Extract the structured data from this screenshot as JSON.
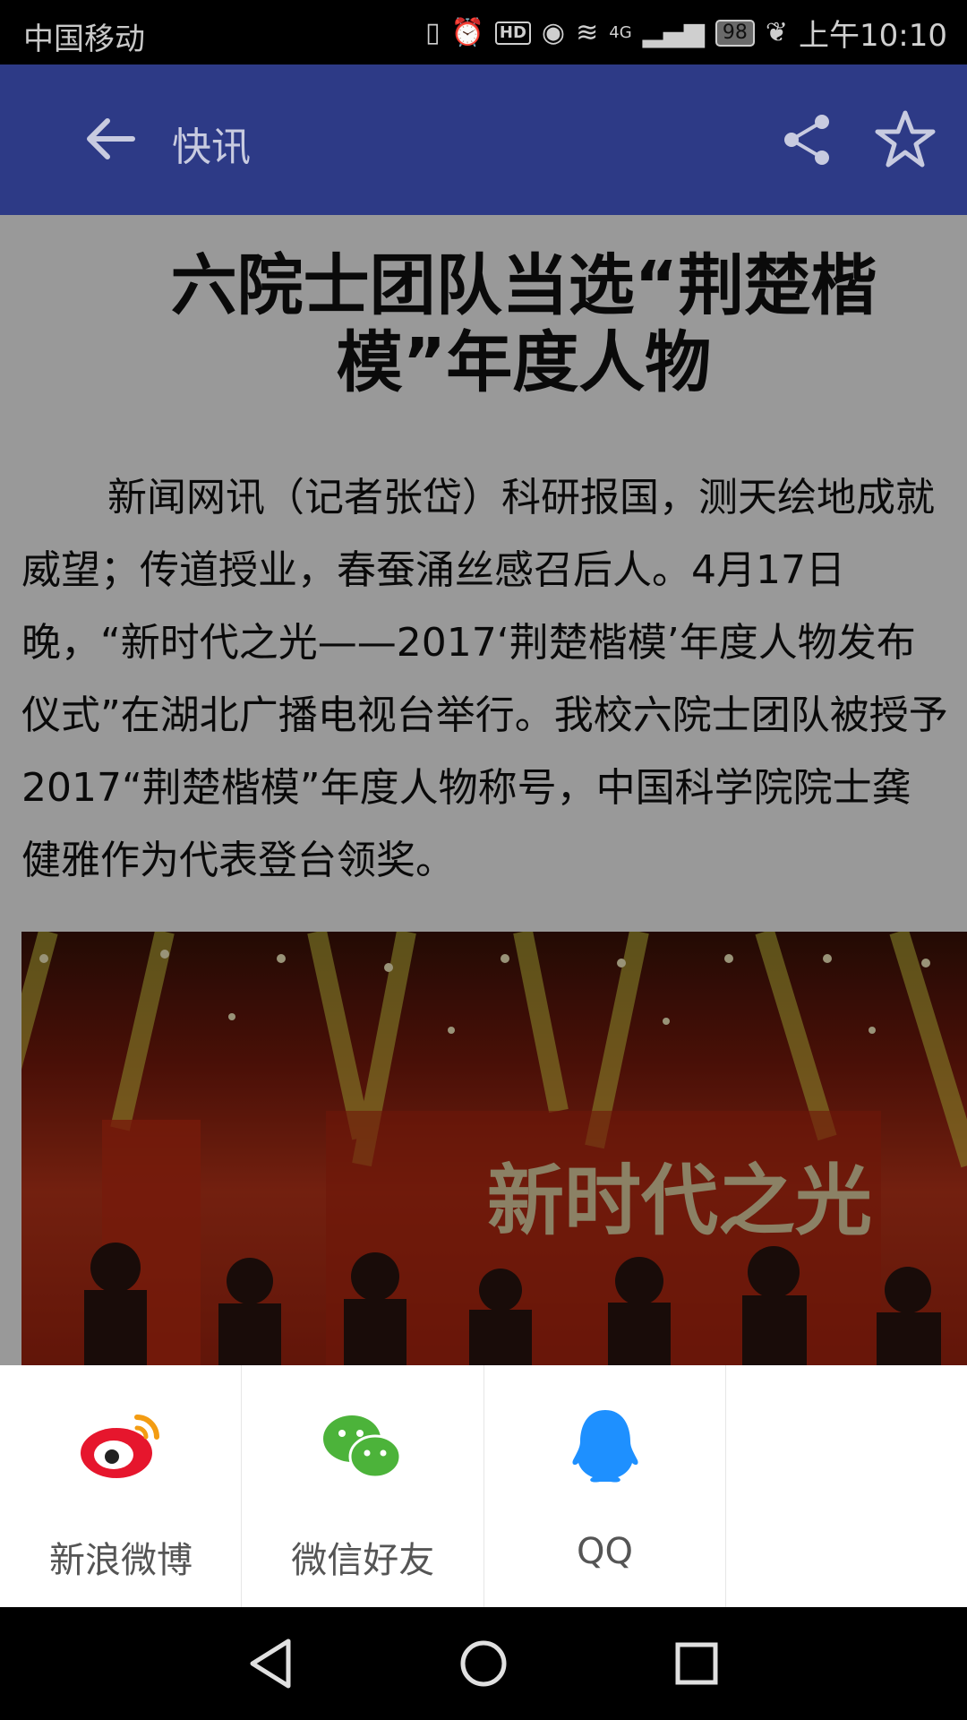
{
  "status_bar": {
    "carrier": "中国移动",
    "network": "4G",
    "hd": "HD",
    "battery": "98",
    "time": "上午10:10"
  },
  "app_bar": {
    "title": "快讯"
  },
  "article": {
    "headline": "六院士团队当选“荆楚楷模”年度人物",
    "body": "新闻网讯（记者张岱）科研报国，测天绘地成就威望；传道授业，春蚕涌丝感召后人。4月17日晚，“新时代之光——2017‘荆楚楷模’年度人物发布仪式”在湖北广播电视台举行。我校六院士团队被授予2017“荆楚楷模”年度人物称号，中国科学院院士龚健雅作为代表登台领奖。",
    "photo_text": "新时代之光"
  },
  "share_sheet": {
    "options": [
      {
        "label": "新浪微博",
        "icon": "weibo-icon",
        "color": "#e6162d"
      },
      {
        "label": "微信好友",
        "icon": "wechat-icon",
        "color": "#4cb33a"
      },
      {
        "label": "QQ",
        "icon": "qq-icon",
        "color": "#1e90ff"
      },
      {
        "label": "",
        "icon": "",
        "color": ""
      }
    ]
  },
  "colors": {
    "app_bar": "#2d3a86"
  }
}
